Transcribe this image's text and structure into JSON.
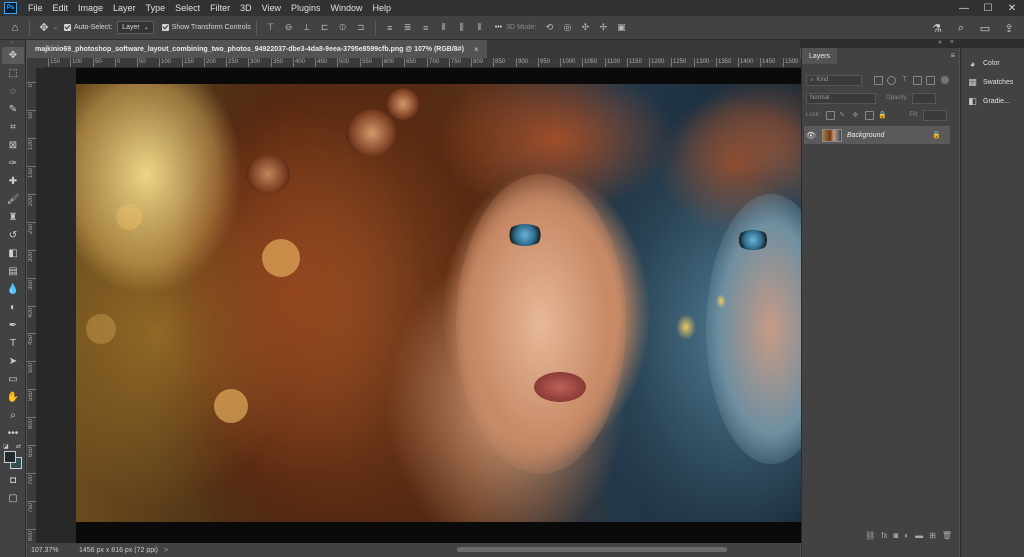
{
  "app": {
    "logo": "Ps",
    "menu": [
      "File",
      "Edit",
      "Image",
      "Layer",
      "Type",
      "Select",
      "Filter",
      "3D",
      "View",
      "Plugins",
      "Window",
      "Help"
    ]
  },
  "options_bar": {
    "auto_select_label": "Auto-Select:",
    "auto_select_value": "Layer",
    "show_transform_label": "Show Transform Controls",
    "three_d_mode_label": "3D Mode:",
    "more_label": "•••"
  },
  "document": {
    "tab_title": "majkinio69_photoshop_software_layout_combining_two_photos_94922037-dbe3-4da8-9eea-3795e8599cfb.png @ 107% (RGB/8#)",
    "close": "×"
  },
  "ruler": {
    "h_labels": [
      "150",
      "100",
      "50",
      "0",
      "50",
      "100",
      "150",
      "200",
      "250",
      "300",
      "350",
      "400",
      "450",
      "500",
      "550",
      "600",
      "650",
      "700",
      "750",
      "800",
      "850",
      "900",
      "950",
      "1000",
      "1050",
      "1100",
      "1150",
      "1200",
      "1250",
      "1300",
      "1350",
      "1400",
      "1450",
      "1500"
    ],
    "v_labels": [
      "0",
      "50",
      "100",
      "150",
      "200",
      "250",
      "300",
      "350",
      "400",
      "450",
      "500",
      "550",
      "600",
      "650",
      "700",
      "750",
      "800"
    ]
  },
  "status": {
    "zoom": "107.37%",
    "doc_info": "1456 px x 816 px (72 ppi)",
    "arrow": ">"
  },
  "layers": {
    "tab_label": "Layers",
    "kind_label": "Kind",
    "blend_mode": "Normal",
    "opacity_label": "Opacity:",
    "lock_label": "Lock:",
    "fill_label": "Fill:",
    "items": [
      {
        "name": "Background",
        "visible": true,
        "locked": true
      }
    ]
  },
  "right_dock": {
    "items": [
      {
        "label": "Color",
        "icon": "color-icon"
      },
      {
        "label": "Swatches",
        "icon": "swatches-icon"
      },
      {
        "label": "Gradie...",
        "icon": "gradients-icon"
      }
    ]
  },
  "colors": {
    "foreground": "#1f2a2e",
    "background": "#2f4f52",
    "accent": "#31a8ff"
  }
}
